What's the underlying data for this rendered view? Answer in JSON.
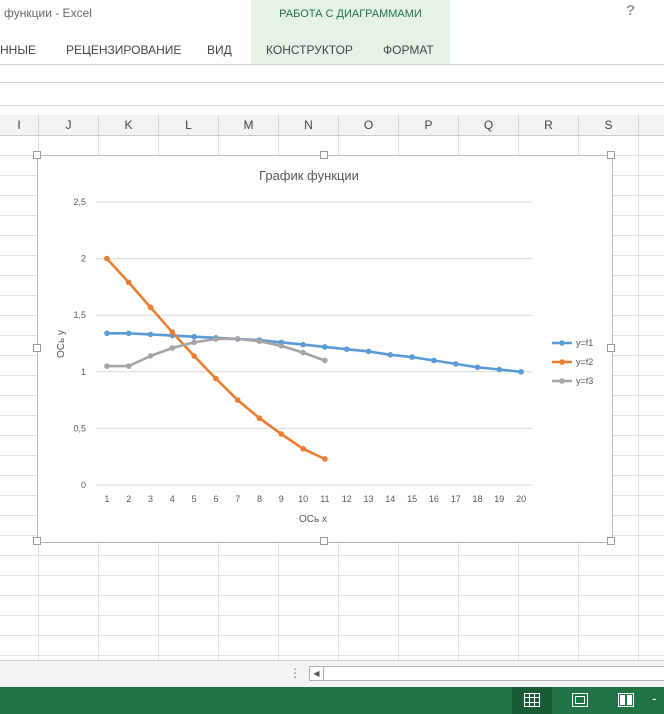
{
  "window": {
    "title": "функции - Excel",
    "help": "?"
  },
  "ribbon": {
    "context_group": "РАБОТА С ДИАГРАММАМИ",
    "tabs": [
      {
        "label": "ННЫЕ"
      },
      {
        "label": "РЕЦЕНЗИРОВАНИЕ"
      },
      {
        "label": "ВИД"
      },
      {
        "label": "КОНСТРУКТОР"
      },
      {
        "label": "ФОРМАТ"
      }
    ]
  },
  "columns": [
    "I",
    "J",
    "K",
    "L",
    "M",
    "N",
    "O",
    "P",
    "Q",
    "R",
    "S"
  ],
  "chart_data": {
    "type": "line",
    "title": "График функции",
    "xlabel": "ОСь x",
    "ylabel": "ОСь y",
    "categories": [
      "1",
      "2",
      "3",
      "4",
      "5",
      "6",
      "7",
      "8",
      "9",
      "10",
      "11",
      "12",
      "13",
      "14",
      "15",
      "16",
      "17",
      "18",
      "19",
      "20"
    ],
    "ylim": [
      0,
      2.5
    ],
    "yticks": [
      "0",
      "0,5",
      "1",
      "1,5",
      "2",
      "2,5"
    ],
    "grid": true,
    "legend_position": "right",
    "series": [
      {
        "name": "y=f1",
        "color": "#5b9bd5",
        "values": [
          1.34,
          1.34,
          1.33,
          1.32,
          1.31,
          1.3,
          1.29,
          1.28,
          1.26,
          1.24,
          1.22,
          1.2,
          1.18,
          1.15,
          1.13,
          1.1,
          1.07,
          1.04,
          1.02,
          1.0
        ]
      },
      {
        "name": "y=f2",
        "color": "#ed7d31",
        "values": [
          2.0,
          1.79,
          1.57,
          1.35,
          1.14,
          0.94,
          0.75,
          0.59,
          0.45,
          0.32,
          0.23
        ]
      },
      {
        "name": "y=f3",
        "color": "#a5a5a5",
        "values": [
          1.05,
          1.05,
          1.14,
          1.21,
          1.26,
          1.29,
          1.29,
          1.27,
          1.23,
          1.17,
          1.1
        ]
      }
    ]
  },
  "colors": {
    "excel_green": "#217346",
    "context_tab_bg": "#e6f2e6"
  },
  "status": {
    "minus": "-"
  }
}
